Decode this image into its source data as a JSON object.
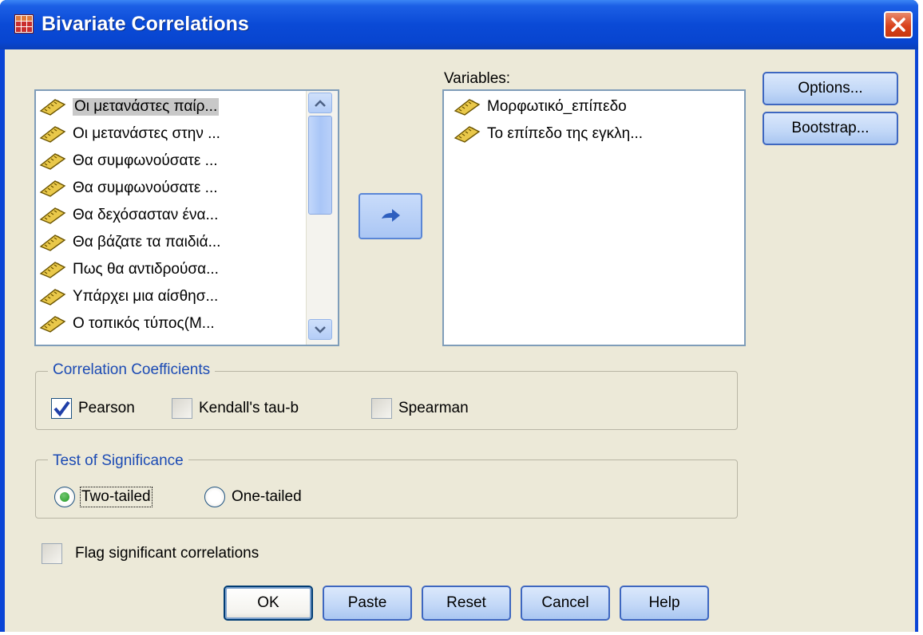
{
  "window": {
    "title": "Bivariate Correlations"
  },
  "source_list": {
    "items": [
      "Οι μετανάστες παίρ...",
      "Οι μετανάστες στην ...",
      "Θα συμφωνούσατε ...",
      "Θα συμφωνούσατε ...",
      "Θα δεχόσασταν ένα...",
      "Θα βάζατε τα παιδιά...",
      "Πως θα αντιδρούσα...",
      "Υπάρχει μια αίσθησ...",
      "Ο τοπικός τύπος(Μ..."
    ],
    "selected_index": 0
  },
  "variables": {
    "label": "Variables:",
    "items": [
      "Μορφωτικό_επίπεδο",
      "Το επίπεδο της εγκλη..."
    ]
  },
  "side_buttons": {
    "options": "Options...",
    "bootstrap": "Bootstrap..."
  },
  "correlation_coefficients": {
    "title": "Correlation Coefficients",
    "pearson": {
      "label": "Pearson",
      "checked": true
    },
    "kendall": {
      "label": "Kendall's tau-b",
      "checked": false
    },
    "spearman": {
      "label": "Spearman",
      "checked": false
    }
  },
  "test_of_significance": {
    "title": "Test of Significance",
    "two_tailed": {
      "label": "Two-tailed",
      "selected": true
    },
    "one_tailed": {
      "label": "One-tailed",
      "selected": false
    }
  },
  "flag": {
    "label": "Flag significant correlations",
    "checked": false
  },
  "bottom_buttons": {
    "ok": "OK",
    "paste": "Paste",
    "reset": "Reset",
    "cancel": "Cancel",
    "help": "Help"
  },
  "colors": {
    "titlebar": "#0a4ad6",
    "dialog_bg": "#ece9d8",
    "group_title": "#1c4bb4",
    "close_button": "#d9421c"
  }
}
